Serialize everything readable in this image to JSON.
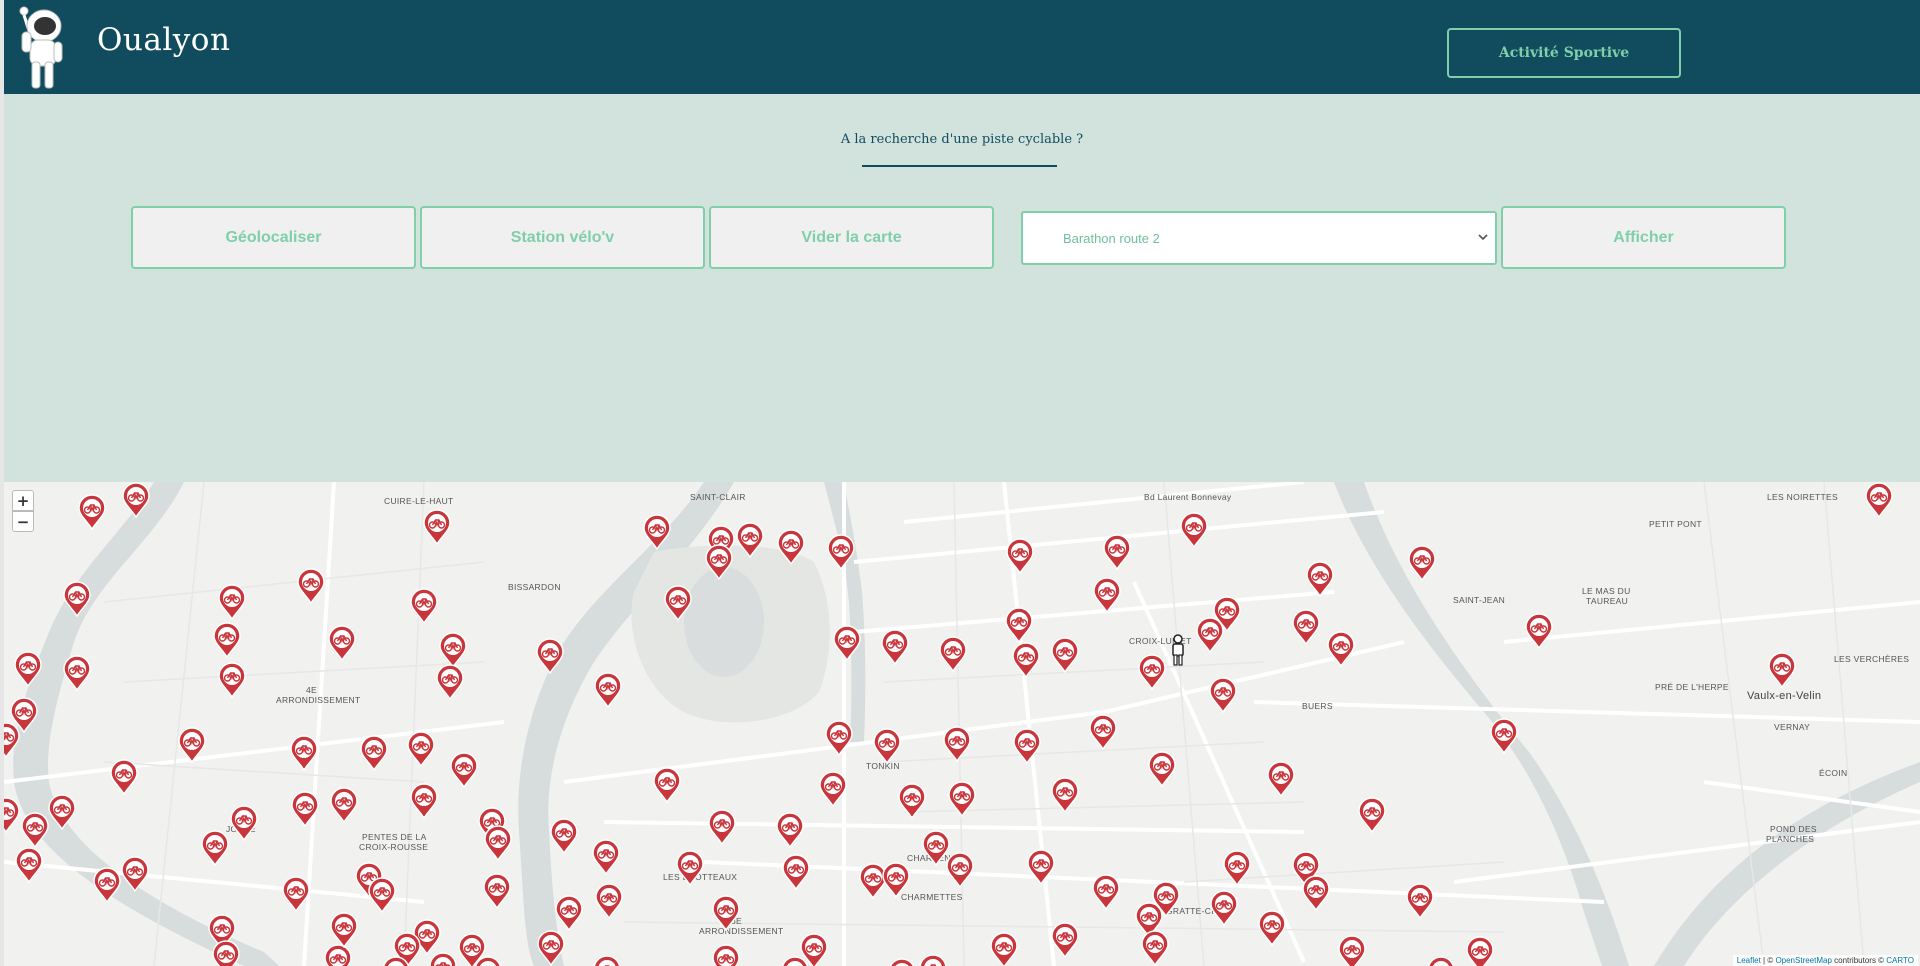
{
  "header": {
    "site_title": "Oualyon",
    "sport_button": "Activité Sportive",
    "logo_icon": "astronaut-logo-icon"
  },
  "panel": {
    "tagline": "A la recherche d'une piste cyclable ?",
    "buttons": {
      "geolocate": "Géolocaliser",
      "station": "Station vélo'v",
      "clear": "Vider la carte",
      "show": "Afficher"
    },
    "route_select": {
      "selected": "Barathon route 2"
    }
  },
  "map": {
    "zoom_in": "+",
    "zoom_out": "−",
    "marker_icon": "bike-station-marker-icon",
    "labels": [
      "CUIRE-LE-HAUT",
      "SAINT-CLAIR",
      "LES NOIRETTES",
      "PETIT PONT",
      "BISSARDON",
      "SAINT-JEAN",
      "LE MAS DU",
      "TAUREAU",
      "CROIX-LUIZET",
      "4E",
      "ARRONDISSEMENT",
      "PRÉ DE L'HERPE",
      "LES VERCHÈRES",
      "Vaulx-en-Velin",
      "BUERS",
      "VERNAY",
      "TONKIN",
      "ÉCOIN",
      "JOUVE",
      "PENTES DE LA",
      "CROIX-ROUSSE",
      "CHARPENNES",
      "POND DES",
      "PLANCHES",
      "LES BROTTEAUX",
      "CHARMETTES",
      "GRATTE-CIEL",
      "6E",
      "ARRONDISSEMENT",
      "Bd Laurent Bonnevay"
    ],
    "attribution": {
      "leaflet": "Leaflet",
      "sep1": " | © ",
      "osm": "OpenStreetMap",
      "contributors": " contributors © ",
      "carto": "CARTO"
    }
  }
}
